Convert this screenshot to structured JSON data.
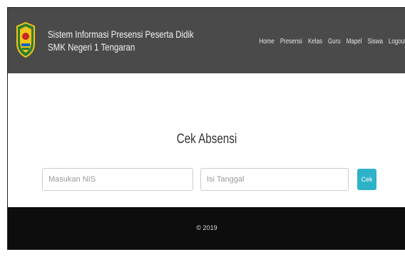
{
  "header": {
    "title_line1": "Sistem Informasi Presensi Peserta Didik",
    "title_line2": "SMK Negeri 1 Tengaran",
    "nav": [
      "Home",
      "Presensi",
      "Kelas",
      "Guru",
      "Mapel",
      "Siswa",
      "Logout"
    ]
  },
  "main": {
    "heading": "Cek Absensi",
    "nis_placeholder": "Masukan NIS",
    "date_placeholder": "Isi Tanggal",
    "check_label": "Cek"
  },
  "footer": {
    "text": "© 2019"
  },
  "colors": {
    "navbar": "#4a4a4a",
    "button": "#2eb2c8",
    "footer": "#0d0d0d"
  }
}
